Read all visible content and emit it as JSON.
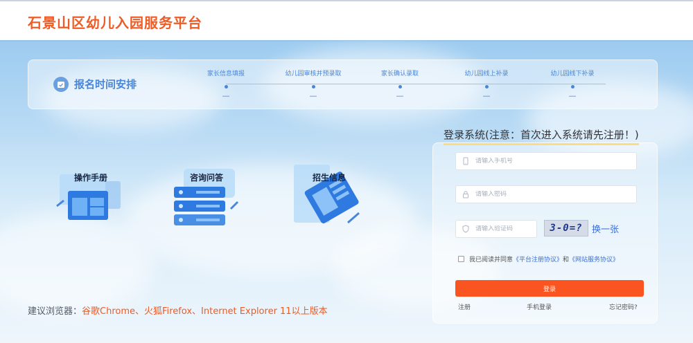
{
  "header": {
    "title": "石景山区幼儿入园服务平台"
  },
  "schedule": {
    "title": "报名时间安排",
    "steps": [
      {
        "name": "家长信息填报",
        "date": "—"
      },
      {
        "name": "幼儿园审核并预录取",
        "date": "—"
      },
      {
        "name": "家长确认录取",
        "date": "—"
      },
      {
        "name": "幼儿园线上补录",
        "date": "—"
      },
      {
        "name": "幼儿园线下补录",
        "date": "—"
      }
    ]
  },
  "tiles": [
    {
      "label": "操作手册",
      "icon": "manual-icon"
    },
    {
      "label": "咨询问答",
      "icon": "server-qa-icon"
    },
    {
      "label": "招生信息",
      "icon": "enrollment-card-icon"
    }
  ],
  "browser_note": {
    "prefix": "建议浏览器：",
    "highlight": "谷歌Chrome、火狐Firefox、Internet Explorer 11以上版本"
  },
  "login": {
    "title": "登录系统(注意：首次进入系统请先注册！)",
    "phone_placeholder": "请输入手机号",
    "password_placeholder": "请输入密码",
    "captcha_placeholder": "请输入验证码",
    "captcha_text": "3-0=?",
    "captcha_refresh": "换一张",
    "agree_prefix": "我已阅读并同意",
    "agree_link1": "《平台注册协议》",
    "agree_and": "和",
    "agree_link2": "《网站服务协议》",
    "submit": "登录",
    "register": "注册",
    "phone_login": "手机登录",
    "forgot": "忘记密码?"
  },
  "colors": {
    "brand": "#f05a23",
    "accent_blue": "#4a86d8",
    "button": "#fa5520",
    "highlight_underline": "#f4c430"
  }
}
